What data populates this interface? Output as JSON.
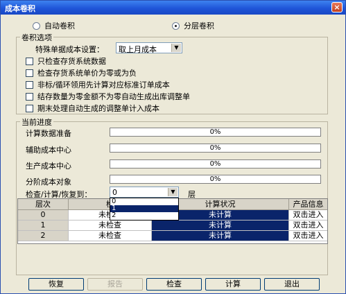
{
  "window": {
    "title": "成本卷积",
    "close_label": "×"
  },
  "mode": {
    "auto_label": "自动卷积",
    "layered_label": "分层卷积",
    "selected": "layered"
  },
  "options": {
    "group_label": "卷积选项",
    "special_price_label": "特殊单据成本设置：",
    "special_price_value": "取上月成本",
    "checkboxes": [
      {
        "label": "只检查存货系统数据",
        "checked": false
      },
      {
        "label": "检查存货系统单价为零或为负",
        "checked": false
      },
      {
        "label": "非标/循环领用先计算对应标准订单成本",
        "checked": false
      },
      {
        "label": "结存数量为零金额不为零自动生成出库调整单",
        "checked": false
      },
      {
        "label": "期末处理自动生成的调整单计入成本",
        "checked": false
      }
    ]
  },
  "progress": {
    "group_label": "当前进度",
    "rows": [
      {
        "label": "计算数据准备",
        "value": "0%",
        "fraction": 0
      },
      {
        "label": "辅助成本中心",
        "value": "0%",
        "fraction": 0
      },
      {
        "label": "生产成本中心",
        "value": "0%",
        "fraction": 0
      },
      {
        "label": "分阶成本对象",
        "value": "0%",
        "fraction": 0
      }
    ],
    "level_label": "检查/计算/恢复到：",
    "level_value": "0",
    "level_unit": "层",
    "level_options": [
      "0",
      "1",
      "2"
    ],
    "level_highlight": "1"
  },
  "table": {
    "headers": [
      "层次",
      "检",
      "计算状况",
      "产品信息"
    ],
    "rows": [
      {
        "level": "0",
        "check": "未检查",
        "calc": "未计算",
        "info": "双击进入"
      },
      {
        "level": "1",
        "check": "未检查",
        "calc": "未计算",
        "info": "双击进入"
      },
      {
        "level": "2",
        "check": "未检查",
        "calc": "未计算",
        "info": "双击进入"
      }
    ]
  },
  "buttons": {
    "restore": "恢复",
    "report": "报告",
    "check": "检查",
    "compute": "计算",
    "exit": "退出"
  }
}
